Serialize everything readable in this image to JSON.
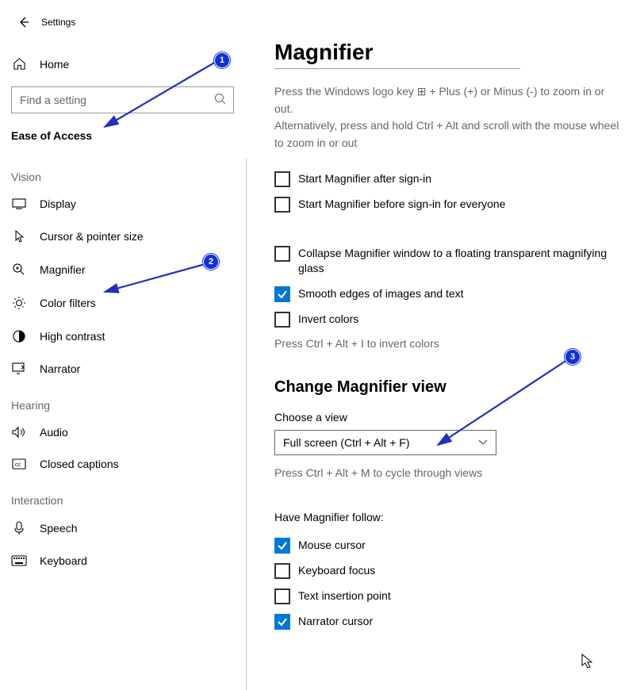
{
  "window_title": "Settings",
  "home_label": "Home",
  "search_placeholder": "Find a setting",
  "category_label": "Ease of Access",
  "groups": {
    "vision": "Vision",
    "hearing": "Hearing",
    "interaction": "Interaction"
  },
  "nav": {
    "display": "Display",
    "cursor": "Cursor & pointer size",
    "magnifier": "Magnifier",
    "color_filters": "Color filters",
    "high_contrast": "High contrast",
    "narrator": "Narrator",
    "audio": "Audio",
    "closed_captions": "Closed captions",
    "speech": "Speech",
    "keyboard": "Keyboard"
  },
  "page_title": "Magnifier",
  "desc_line1": "Press the Windows logo key ⊞  + Plus (+) or Minus (-) to zoom in or out.",
  "desc_line2": "Alternatively, press and hold Ctrl + Alt and scroll with the mouse wheel to zoom in or out",
  "checks": {
    "start_after": "Start Magnifier after sign-in",
    "start_before": "Start Magnifier before sign-in for everyone",
    "collapse": "Collapse Magnifier window to a floating transparent magnifying glass",
    "smooth": "Smooth edges of images and text",
    "invert": "Invert colors"
  },
  "invert_hint": "Press Ctrl + Alt + I to invert colors",
  "section_change": "Change Magnifier view",
  "choose_label": "Choose a view",
  "select_value": "Full screen (Ctrl + Alt + F)",
  "cycle_hint": "Press Ctrl + Alt + M to cycle through views",
  "follow_label": "Have Magnifier follow:",
  "follow": {
    "mouse": "Mouse cursor",
    "keyboard": "Keyboard focus",
    "text": "Text insertion point",
    "narrator": "Narrator cursor"
  },
  "annotations": {
    "b1": "1",
    "b2": "2",
    "b3": "3"
  }
}
